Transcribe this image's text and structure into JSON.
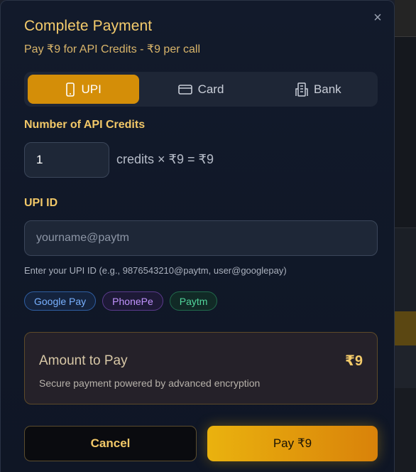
{
  "modal": {
    "title": "Complete Payment",
    "subtitle": "Pay ₹9 for API Credits - ₹9 per call",
    "close_icon": "×"
  },
  "tabs": [
    {
      "label": "UPI",
      "icon": "smartphone-icon",
      "active": true
    },
    {
      "label": "Card",
      "icon": "credit-card-icon",
      "active": false
    },
    {
      "label": "Bank",
      "icon": "building-icon",
      "active": false
    }
  ],
  "credits": {
    "label": "Number of API Credits",
    "value": "1",
    "calculation": "credits × ₹9 = ₹9"
  },
  "upi": {
    "label": "UPI ID",
    "placeholder": "yourname@paytm",
    "helper": "Enter your UPI ID (e.g., 9876543210@paytm, user@googlepay)",
    "apps": [
      "Google Pay",
      "PhonePe",
      "Paytm"
    ]
  },
  "amount": {
    "label": "Amount to Pay",
    "value": "₹9",
    "note": "Secure payment powered by advanced encryption"
  },
  "buttons": {
    "cancel": "Cancel",
    "pay": "Pay ₹9"
  },
  "colors": {
    "accent": "#d48e08",
    "title": "#f5cc6c",
    "background": "#121a2b"
  }
}
